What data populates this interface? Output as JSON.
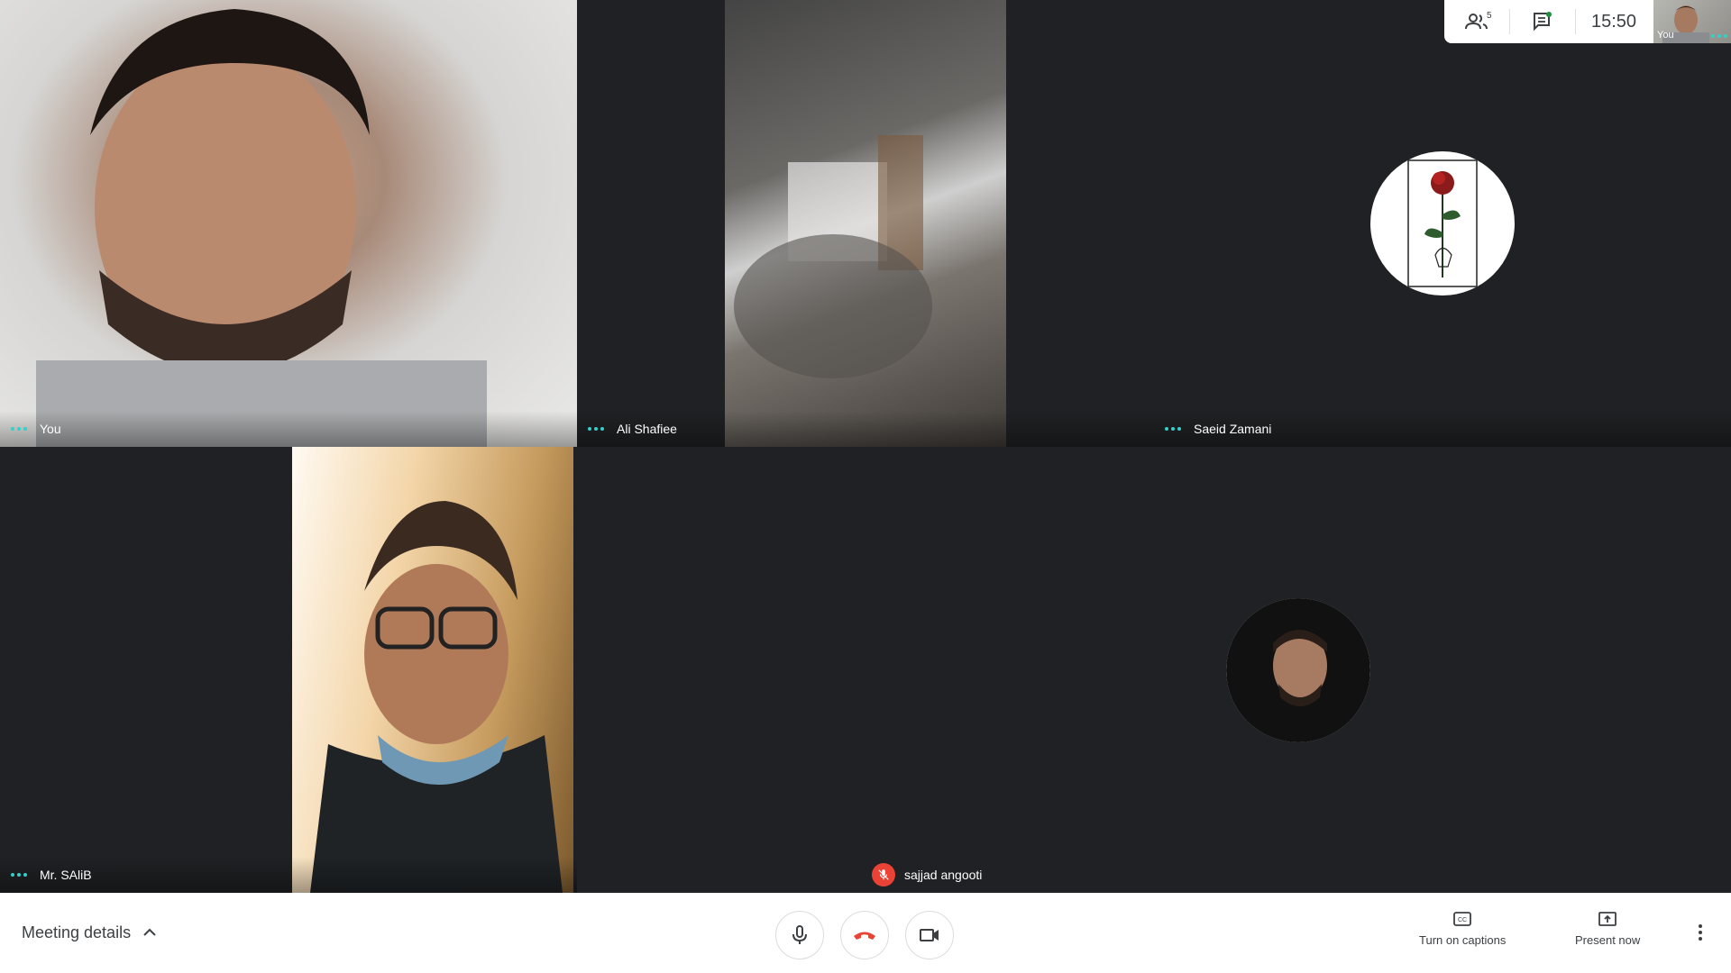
{
  "topbar": {
    "participants_count": "5",
    "clock": "15:50",
    "self_label": "You"
  },
  "tiles": [
    {
      "name": "You",
      "status": "dots"
    },
    {
      "name": "Ali Shafiee",
      "status": "dots"
    },
    {
      "name": "Saeid Zamani",
      "status": "dots"
    },
    {
      "name": "Mr. SAliB",
      "status": "dots"
    },
    {
      "name": "sajjad angooti",
      "status": "muted"
    }
  ],
  "bottombar": {
    "meeting_details_label": "Meeting details",
    "captions_label": "Turn on captions",
    "present_label": "Present now"
  },
  "colors": {
    "stage_bg": "#202124",
    "hangup_red": "#ea4335",
    "dots_teal": "#33d1c8",
    "chat_badge": "#1e8e3e"
  },
  "icons": [
    "people-icon",
    "chat-icon",
    "microphone-icon",
    "hang-up-icon",
    "camera-icon",
    "captions-icon",
    "present-icon",
    "more-vert-icon",
    "mic-off-icon",
    "chevron-up-icon"
  ]
}
